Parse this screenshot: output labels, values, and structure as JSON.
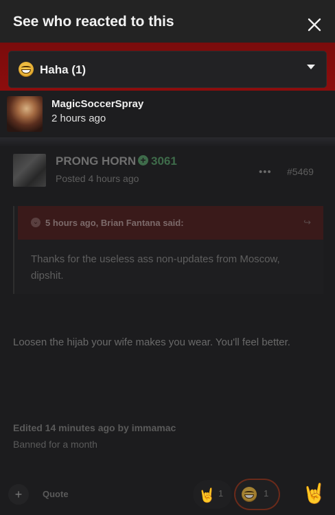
{
  "modal": {
    "title": "See who reacted to this",
    "close_icon": "close-icon",
    "filter": {
      "label": "Haha (1)",
      "icon": "laughing-face-icon"
    },
    "reactors": [
      {
        "name": "MagicSoccerSpray",
        "time": "2 hours ago"
      }
    ]
  },
  "post": {
    "author": "PRONG HORN",
    "reputation": "3061",
    "posted": "Posted 4 hours ago",
    "more_icon": "•••",
    "number": "#5469",
    "quote": {
      "citation": "5 hours ago, Brian Fantana said:",
      "text": "Thanks for the useless ass non-updates from Moscow, dipshit."
    },
    "body": "Loosen the hijab your wife makes you wear.  You'll feel better.",
    "edited_prefix": "Edited 14 minutes ago by ",
    "edited_by": "immamac",
    "edit_reason": "Banned for a month"
  },
  "footer": {
    "plus": "+",
    "quote_label": "Quote",
    "reactions": [
      {
        "icon": "rock-on-hand-icon",
        "count": "1"
      },
      {
        "icon": "laughing-face-icon",
        "count": "1"
      }
    ],
    "react_button_icon": "rock-on-hand-icon"
  },
  "colors": {
    "accent_red": "#8d0d0d",
    "reputation_green": "#3e6b4a"
  }
}
